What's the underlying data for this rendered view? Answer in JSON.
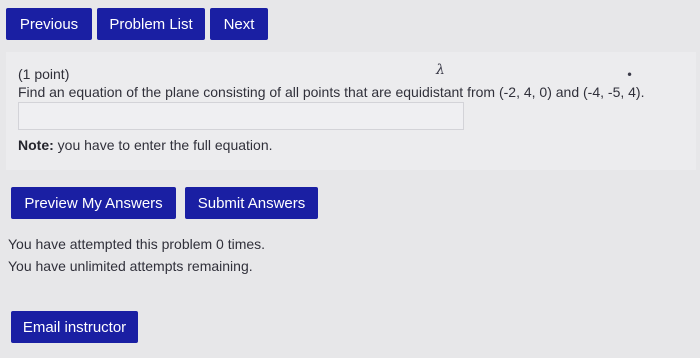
{
  "nav": {
    "previous": "Previous",
    "problem_list": "Problem List",
    "next": "Next"
  },
  "problem": {
    "points": "(1 point)",
    "question": "Find an equation of the plane consisting of all points that are equidistant from (-2, 4, 0) and (-4, -5, 4).",
    "answer_value": "",
    "note_label": "Note:",
    "note_text": " you have to enter the full equation."
  },
  "actions": {
    "preview": "Preview My Answers",
    "submit": "Submit Answers"
  },
  "status": {
    "attempted": "You have attempted this problem 0 times.",
    "remaining": "You have unlimited attempts remaining."
  },
  "footer": {
    "email": "Email instructor"
  },
  "colors": {
    "button_bg": "#1a1fa3",
    "button_text": "#ffffff",
    "page_bg": "#e7e7e9"
  }
}
